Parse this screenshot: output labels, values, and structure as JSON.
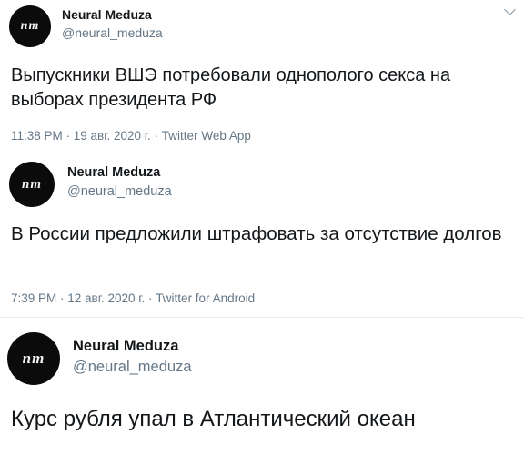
{
  "tweets": [
    {
      "avatar_text": "nm",
      "author_name": "Neural Meduza",
      "author_handle": "@neural_meduza",
      "text": "Выпускники ВШЭ потребовали однополого секса на выборах президента РФ",
      "meta": "11:38 PM · 19 авг. 2020 г. · Twitter Web App",
      "menu_icon": "chevron-down-icon"
    },
    {
      "avatar_text": "nm",
      "author_name": "Neural Meduza",
      "author_handle": "@neural_meduza",
      "text": "В России предложили штрафовать за отсутствие долгов",
      "meta": "7:39 PM · 12 авг. 2020 г. · Twitter for Android"
    },
    {
      "avatar_text": "nm",
      "author_name": "Neural Meduza",
      "author_handle": "@neural_meduza",
      "text": "Курс рубля упал в Атлантический океан"
    }
  ],
  "colors": {
    "text_primary": "#14171a",
    "text_secondary": "#657786",
    "avatar_bg": "#0b0b0b",
    "divider": "#e6ecf0"
  }
}
